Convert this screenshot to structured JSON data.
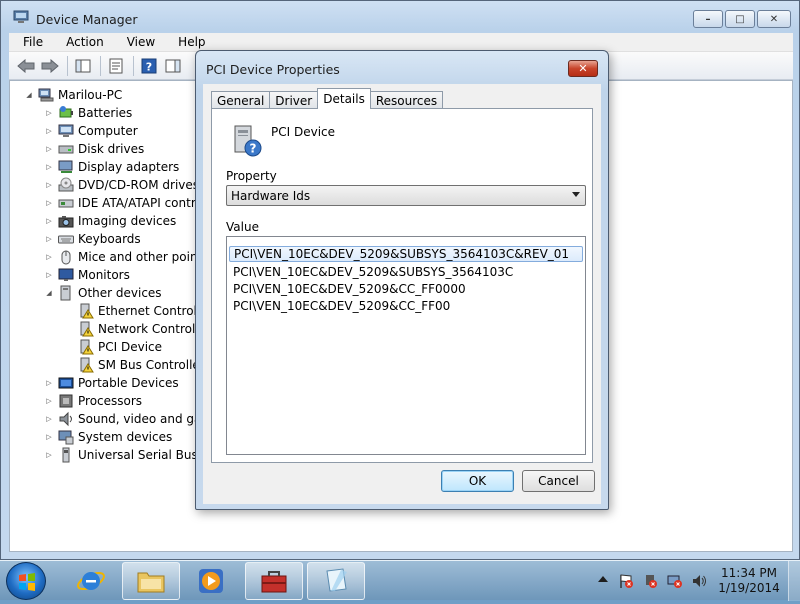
{
  "window": {
    "title": "Device Manager",
    "menu": [
      "File",
      "Action",
      "View",
      "Help"
    ],
    "caption": {
      "minimize": "–",
      "maximize": "□",
      "close": "✕"
    }
  },
  "tree": {
    "root": "Marilou-PC",
    "categories": [
      {
        "label": "Batteries",
        "icon": "battery-icon"
      },
      {
        "label": "Computer",
        "icon": "computer-icon"
      },
      {
        "label": "Disk drives",
        "icon": "disk-drive-icon"
      },
      {
        "label": "Display adapters",
        "icon": "display-adapter-icon"
      },
      {
        "label": "DVD/CD-ROM drives",
        "icon": "dvd-drive-icon"
      },
      {
        "label": "IDE ATA/ATAPI contro",
        "icon": "ide-controller-icon"
      },
      {
        "label": "Imaging devices",
        "icon": "camera-icon"
      },
      {
        "label": "Keyboards",
        "icon": "keyboard-icon"
      },
      {
        "label": "Mice and other pointin",
        "icon": "mouse-icon"
      },
      {
        "label": "Monitors",
        "icon": "monitor-icon"
      },
      {
        "label": "Other devices",
        "icon": "other-devices-icon",
        "expanded": true
      }
    ],
    "other_devices": [
      "Ethernet Controller",
      "Network Controller",
      "PCI Device",
      "SM Bus Controller"
    ],
    "more_categories": [
      {
        "label": "Portable Devices",
        "icon": "portable-device-icon"
      },
      {
        "label": "Processors",
        "icon": "processor-icon"
      },
      {
        "label": "Sound, video and gam",
        "icon": "speaker-icon"
      },
      {
        "label": "System devices",
        "icon": "system-devices-icon"
      },
      {
        "label": "Universal Serial Bus co",
        "icon": "usb-icon"
      }
    ]
  },
  "dialog": {
    "title": "PCI Device Properties",
    "close": "✕",
    "tabs": [
      "General",
      "Driver",
      "Details",
      "Resources"
    ],
    "active_tab": "Details",
    "device_name": "PCI Device",
    "property_label": "Property",
    "property_value": "Hardware Ids",
    "value_label": "Value",
    "values": [
      "PCI\\VEN_10EC&DEV_5209&SUBSYS_3564103C&REV_01",
      "PCI\\VEN_10EC&DEV_5209&SUBSYS_3564103C",
      "PCI\\VEN_10EC&DEV_5209&CC_FF0000",
      "PCI\\VEN_10EC&DEV_5209&CC_FF00"
    ],
    "ok": "OK",
    "cancel": "Cancel"
  },
  "taskbar": {
    "time": "11:34 PM",
    "date": "1/19/2014"
  }
}
